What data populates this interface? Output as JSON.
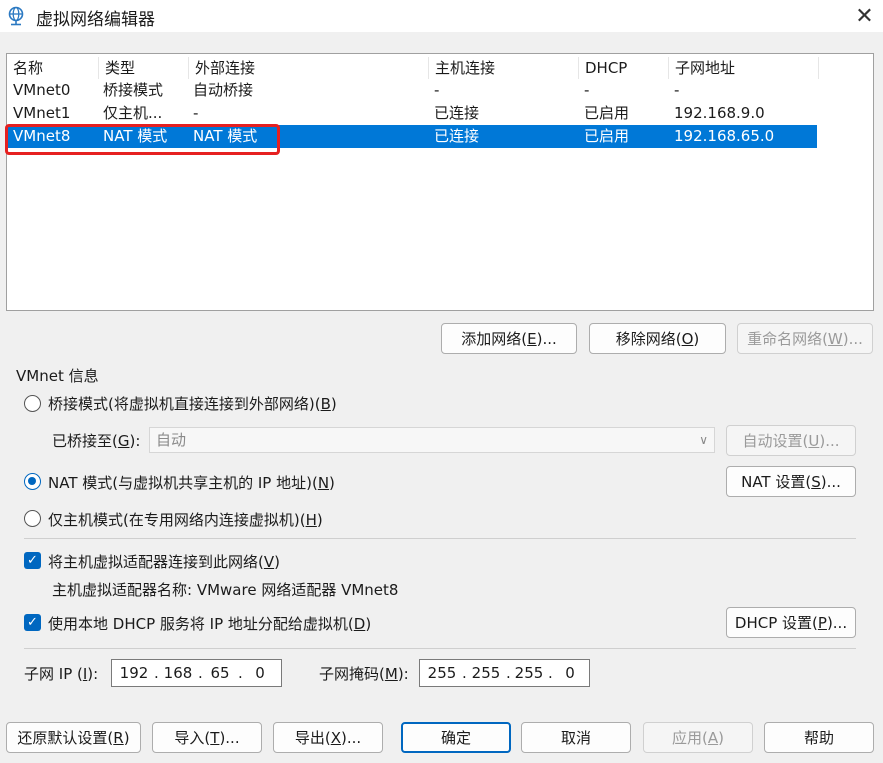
{
  "window": {
    "title": "虚拟网络编辑器",
    "close_label": "✕"
  },
  "table": {
    "headers": [
      "名称",
      "类型",
      "外部连接",
      "主机连接",
      "DHCP",
      "子网地址"
    ],
    "rows": [
      {
        "name": "VMnet0",
        "type": "桥接模式",
        "external": "自动桥接",
        "host": "-",
        "dhcp": "-",
        "subnet": "-"
      },
      {
        "name": "VMnet1",
        "type": "仅主机...",
        "external": "-",
        "host": "已连接",
        "dhcp": "已启用",
        "subnet": "192.168.9.0"
      },
      {
        "name": "VMnet8",
        "type": "NAT 模式",
        "external": "NAT 模式",
        "host": "已连接",
        "dhcp": "已启用",
        "subnet": "192.168.65.0"
      }
    ],
    "selected_index": 2
  },
  "list_buttons": {
    "add": {
      "pre": "添加网络(",
      "key": "E",
      "post": ")..."
    },
    "remove": {
      "pre": "移除网络(",
      "key": "O",
      "post": ")"
    },
    "rename": {
      "pre": "重命名网络(",
      "key": "W",
      "post": ")..."
    }
  },
  "vmnet_info": {
    "title": "VMnet 信息",
    "bridged": {
      "pre": "桥接模式(将虚拟机直接连接到外部网络)(",
      "key": "B",
      "post": ")"
    },
    "bridged_to": {
      "pre": "已桥接至(",
      "key": "G",
      "post": "):"
    },
    "bridged_combo_value": "自动",
    "auto_settings": {
      "pre": "自动设置(",
      "key": "U",
      "post": ")..."
    },
    "nat": {
      "pre": "NAT 模式(与虚拟机共享主机的 IP 地址)(",
      "key": "N",
      "post": ")"
    },
    "nat_settings": {
      "pre": "NAT 设置(",
      "key": "S",
      "post": ")..."
    },
    "hostonly": {
      "pre": "仅主机模式(在专用网络内连接虚拟机)(",
      "key": "H",
      "post": ")"
    },
    "connect_adapter": {
      "pre": "将主机虚拟适配器连接到此网络(",
      "key": "V",
      "post": ")"
    },
    "adapter_name": "主机虚拟适配器名称: VMware 网络适配器 VMnet8",
    "use_dhcp": {
      "pre": "使用本地 DHCP 服务将 IP 地址分配给虚拟机(",
      "key": "D",
      "post": ")"
    },
    "dhcp_settings": {
      "pre": "DHCP 设置(",
      "key": "P",
      "post": ")..."
    },
    "subnet_ip_label": {
      "pre": "子网 IP (",
      "key": "I",
      "post": "):"
    },
    "subnet_ip": [
      "192",
      "168",
      "65",
      "0"
    ],
    "subnet_mask_label": {
      "pre": "子网掩码(",
      "key": "M",
      "post": "):"
    },
    "subnet_mask": [
      "255",
      "255",
      "255",
      "0"
    ],
    "selected_mode": "nat",
    "connect_adapter_checked": true,
    "use_dhcp_checked": true
  },
  "footer": {
    "restore": {
      "pre": "还原默认设置(",
      "key": "R",
      "post": ")"
    },
    "import": {
      "pre": "导入(",
      "key": "T",
      "post": ")..."
    },
    "export": {
      "pre": "导出(",
      "key": "X",
      "post": ")..."
    },
    "ok": "确定",
    "cancel": "取消",
    "apply": {
      "pre": "应用(",
      "key": "A",
      "post": ")"
    },
    "help": "帮助"
  },
  "colors": {
    "selection": "#0078d7",
    "accent": "#0067c0",
    "highlight_box": "#e62020"
  }
}
